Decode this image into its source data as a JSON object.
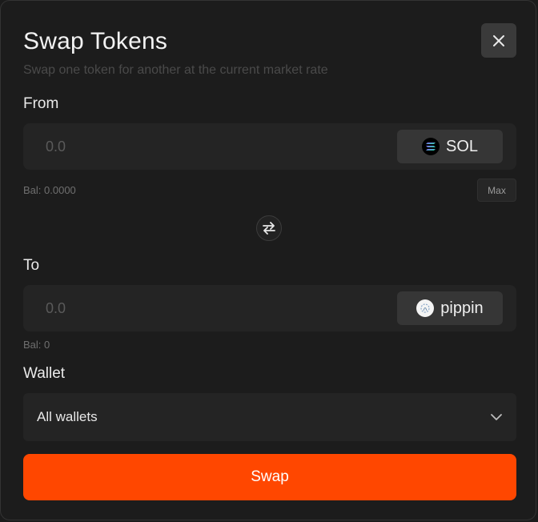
{
  "dialog": {
    "title": "Swap Tokens",
    "subtitle": "Swap one token for another at the current market rate"
  },
  "from": {
    "label": "From",
    "amount_placeholder": "0.0",
    "token": "SOL",
    "balance": "Bal: 0.0000",
    "max_label": "Max"
  },
  "to": {
    "label": "To",
    "amount_placeholder": "0.0",
    "token": "pippin",
    "balance": "Bal: 0"
  },
  "wallet": {
    "label": "Wallet",
    "selected": "All wallets"
  },
  "actions": {
    "swap_label": "Swap"
  },
  "icons": {
    "close": "close-icon",
    "sol": "solana-icon",
    "pippin": "pippin-icon",
    "swap_direction": "swap-arrows-icon",
    "chevron": "chevron-down-icon"
  },
  "colors": {
    "accent": "#ff4700",
    "background": "#1c1c1c",
    "field": "#242424",
    "token_button": "#363636"
  }
}
